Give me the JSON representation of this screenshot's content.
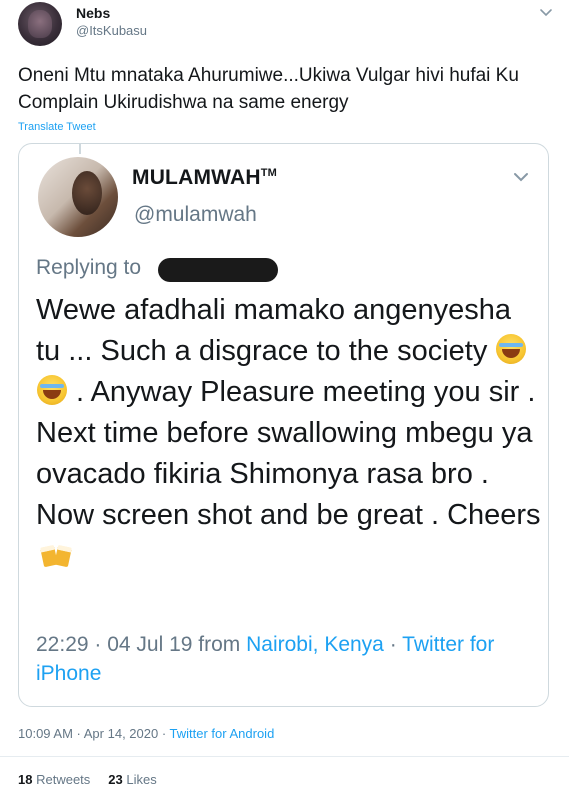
{
  "author": {
    "name": "Nebs",
    "handle": "@ItsKubasu"
  },
  "tweet": {
    "text": "Oneni Mtu mnataka Ahurumiwe...Ukiwa Vulgar hivi hufai Ku Complain Ukirudishwa na same energy",
    "translate_label": "Translate Tweet"
  },
  "quoted_tweet": {
    "name": "MULAMWAH",
    "name_mark": "TM",
    "handle": "@mulamwah",
    "replying_to_label": "Replying to",
    "text_part1": "Wewe afadhali mamako angenyesha tu ... Such a disgrace to the society ",
    "text_part2": " . Anyway Pleasure meeting you sir . Next time before swallowing mbegu ya ovacado fikiria Shimonya rasa bro . Now screen shot and be great . Cheers ",
    "emoji_names": [
      "tears-of-joy-emoji",
      "tears-of-joy-emoji",
      "clinking-beer-mugs-emoji"
    ],
    "time": "22:29 · 04 Jul 19 from ",
    "location": "Nairobi, Kenya",
    "separator": " · ",
    "source": "Twitter for iPhone"
  },
  "meta": {
    "timestamp": "10:09 AM · Apr 14, 2020 · ",
    "source": "Twitter for Android"
  },
  "stats": {
    "retweets_count": "18",
    "retweets_label": "Retweets",
    "likes_count": "23",
    "likes_label": "Likes"
  },
  "colors": {
    "accent": "#1da1f2",
    "secondary_text": "#657786",
    "border": "#cfd9de"
  }
}
